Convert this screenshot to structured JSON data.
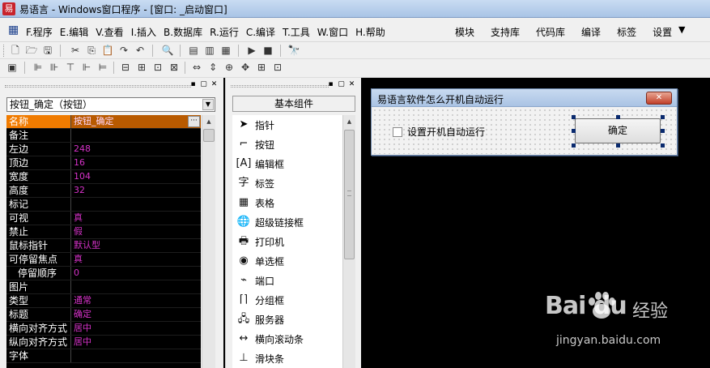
{
  "window": {
    "title": "易语言 - Windows窗口程序 - [窗口: _启动窗口]"
  },
  "menu": {
    "items": [
      "F.程序",
      "E.编辑",
      "V.查看",
      "I.插入",
      "B.数据库",
      "R.运行",
      "C.编译",
      "T.工具",
      "W.窗口",
      "H.帮助"
    ],
    "right_items": [
      "模块",
      "支持库",
      "代码库",
      "编译",
      "标签",
      "设置"
    ]
  },
  "property_panel": {
    "selected_component": "按钮_确定（按钮）",
    "rows": [
      {
        "name": "名称",
        "value": "按钮_确定"
      },
      {
        "name": "备注",
        "value": ""
      },
      {
        "name": "左边",
        "value": "248"
      },
      {
        "name": "顶边",
        "value": "16"
      },
      {
        "name": "宽度",
        "value": "104"
      },
      {
        "name": "高度",
        "value": "32"
      },
      {
        "name": "标记",
        "value": ""
      },
      {
        "name": "可视",
        "value": "真"
      },
      {
        "name": "禁止",
        "value": "假"
      },
      {
        "name": "鼠标指针",
        "value": "默认型"
      },
      {
        "name": "可停留焦点",
        "value": "真"
      },
      {
        "name": "  停留顺序",
        "value": "0"
      },
      {
        "name": "图片",
        "value": ""
      },
      {
        "name": "类型",
        "value": "通常"
      },
      {
        "name": "标题",
        "value": "确定"
      },
      {
        "name": "横向对齐方式",
        "value": "居中"
      },
      {
        "name": "纵向对齐方式",
        "value": "居中"
      },
      {
        "name": "字体",
        "value": ""
      }
    ]
  },
  "component_panel": {
    "header": "基本组件",
    "items": [
      {
        "label": "指针",
        "icon": "pointer-icon"
      },
      {
        "label": "按钮",
        "icon": "button-icon"
      },
      {
        "label": "编辑框",
        "icon": "editbox-icon"
      },
      {
        "label": "标签",
        "icon": "label-icon"
      },
      {
        "label": "表格",
        "icon": "grid-icon"
      },
      {
        "label": "超级链接框",
        "icon": "hyperlink-icon"
      },
      {
        "label": "打印机",
        "icon": "printer-icon"
      },
      {
        "label": "单选框",
        "icon": "radio-icon"
      },
      {
        "label": "端口",
        "icon": "port-icon"
      },
      {
        "label": "分组框",
        "icon": "groupbox-icon"
      },
      {
        "label": "服务器",
        "icon": "server-icon"
      },
      {
        "label": "横向滚动条",
        "icon": "hscrollbar-icon"
      },
      {
        "label": "滑块条",
        "icon": "slider-icon"
      }
    ]
  },
  "form": {
    "title": "易语言软件怎么开机自动运行",
    "checkbox_label": "设置开机自动运行",
    "button_label": "确定"
  },
  "watermark": {
    "logo": "Bai du",
    "cn": "经验",
    "url": "jingyan.baidu.com"
  }
}
